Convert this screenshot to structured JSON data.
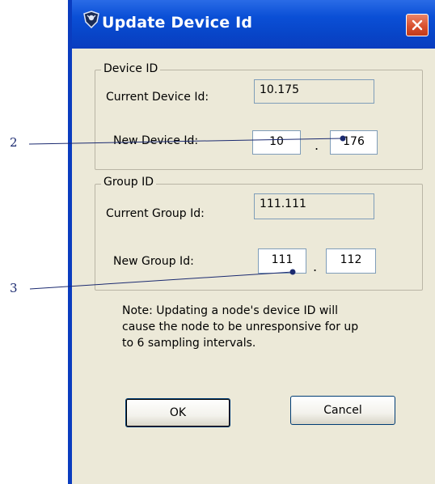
{
  "window": {
    "title": "Update Device Id",
    "icon": "app-shield-icon",
    "close_icon": "close-icon"
  },
  "device_group": {
    "legend": "Device ID",
    "current_label": "Current Device Id:",
    "current_value": "10.175",
    "new_label": "New Device Id:",
    "new_value_1": "10",
    "separator": ".",
    "new_value_2": "176"
  },
  "group_group": {
    "legend": "Group ID",
    "current_label": "Current Group Id:",
    "current_value": "111.111",
    "new_label": "New Group Id:",
    "new_value_1": "111",
    "separator": ".",
    "new_value_2": "112"
  },
  "note": "Note: Updating a node's device ID will cause the node to be unresponsive for up to 6 sampling intervals.",
  "buttons": {
    "ok": "OK",
    "cancel": "Cancel"
  },
  "callouts": {
    "c2": "2",
    "c3": "3"
  }
}
